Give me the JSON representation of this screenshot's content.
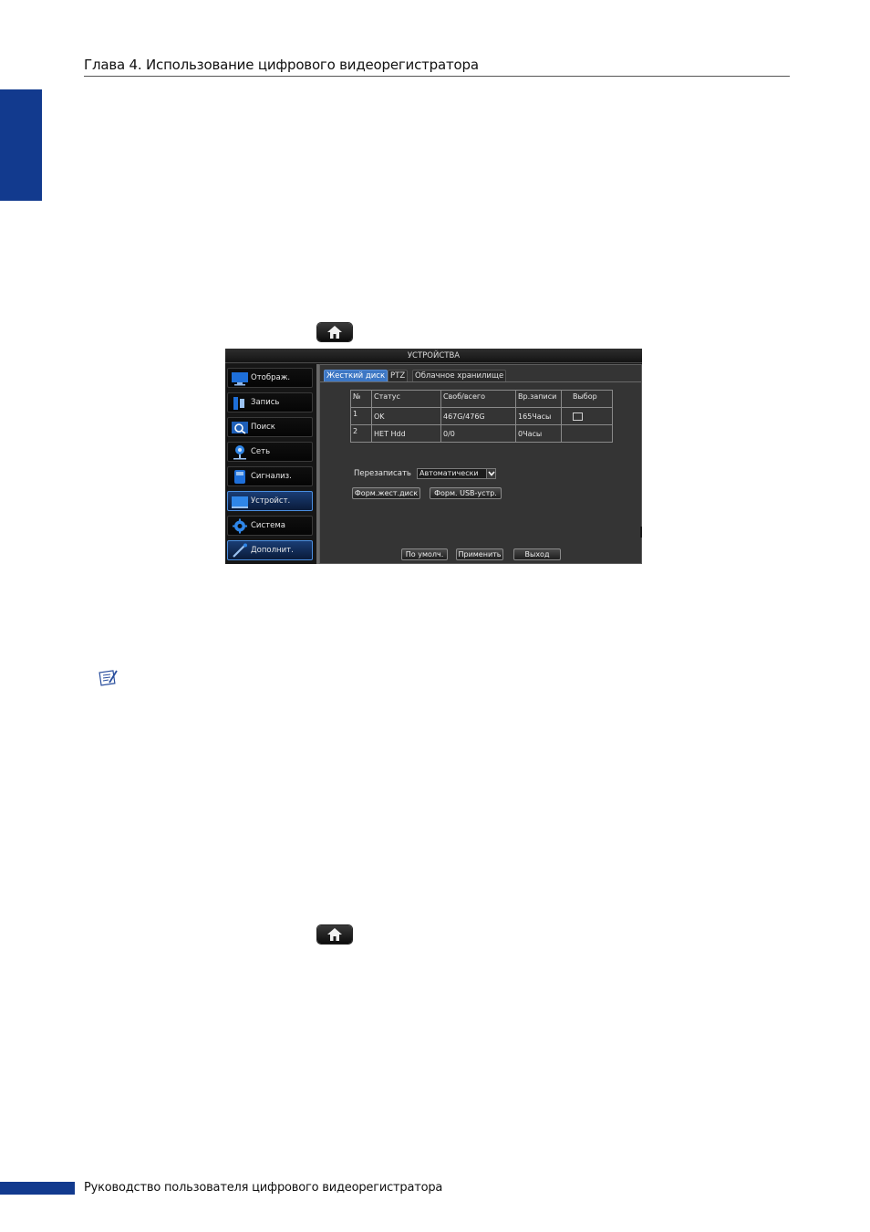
{
  "page": {
    "header_title": "Глава 4. Использование цифрового видеорегистратора",
    "footer_text": "Руководство пользователя цифрового видеорегистратора",
    "colors": {
      "accent": "#123a8e"
    }
  },
  "icons": {
    "home": "home-icon",
    "note": "note-icon"
  },
  "dvr": {
    "title": "УСТРОЙСТВА",
    "menu": [
      {
        "label": "Отображ.",
        "icon": "monitor-icon"
      },
      {
        "label": "Запись",
        "icon": "record-icon"
      },
      {
        "label": "Поиск",
        "icon": "search-icon"
      },
      {
        "label": "Сеть",
        "icon": "network-icon"
      },
      {
        "label": "Сигнализ.",
        "icon": "alarm-icon"
      },
      {
        "label": "Устройст.",
        "icon": "device-icon",
        "active": true
      },
      {
        "label": "Система",
        "icon": "gear-icon"
      },
      {
        "label": "Дополнит.",
        "icon": "tools-icon"
      }
    ],
    "tabs": [
      "Жесткий диск",
      "PTZ",
      "Облачное хранилище"
    ],
    "table": {
      "headers": [
        "№",
        "Статус",
        "Своб/всего",
        "Вр.записи",
        "Выбор"
      ],
      "rows": [
        [
          "1",
          "OK",
          "467G/476G",
          "165Часы",
          ""
        ],
        [
          "2",
          "НЕТ Hdd",
          "0/0",
          "0Часы",
          ""
        ]
      ]
    },
    "overwrite": {
      "label": "Перезаписать",
      "value": "Автоматически"
    },
    "buttons": {
      "format_hdd": "Форм.жест.диск",
      "format_usb": "Форм. USB-устр.",
      "default": "По умолч.",
      "apply": "Применить",
      "exit": "Выход"
    }
  }
}
